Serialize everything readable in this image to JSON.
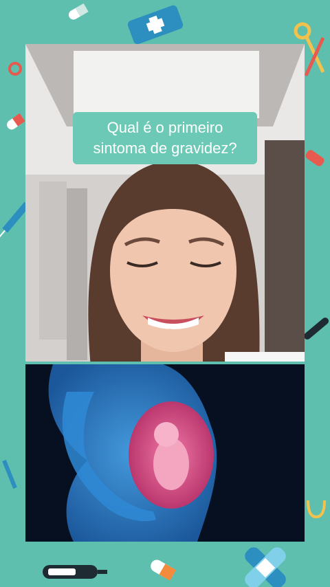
{
  "caption": {
    "line1": "Qual é o primeiro",
    "line2": "sintoma de gravidez?"
  },
  "colors": {
    "background": "#5fbfae",
    "caption_bg": "#6cc9b6",
    "caption_text": "#ffffff",
    "hair": "#5a3c2f",
    "skin": "#f0c6ae",
    "illustration_body": "#2f89d6",
    "illustration_womb": "#e34d88"
  },
  "icons": [
    "pill-icon",
    "first-aid-kit-icon",
    "scissors-icon",
    "syringe-icon",
    "bandage-icon",
    "thermometer-icon",
    "stethoscope-icon"
  ]
}
